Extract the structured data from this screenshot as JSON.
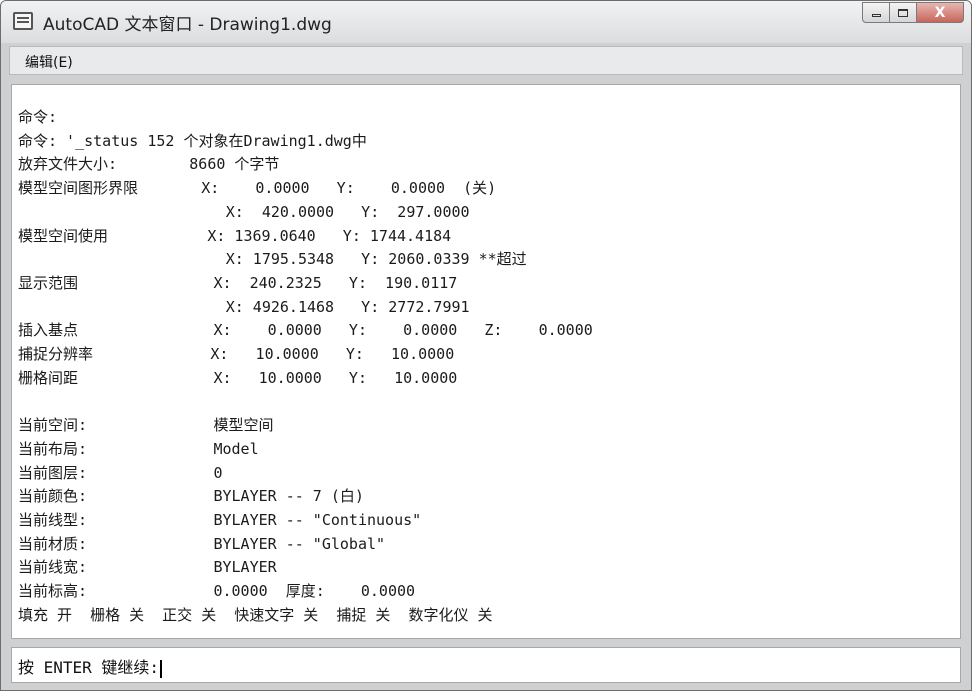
{
  "window": {
    "title": "AutoCAD 文本窗口 - Drawing1.dwg",
    "minimize_symbol": "",
    "maximize_symbol": "",
    "close_symbol": "X"
  },
  "menubar": {
    "edit_label": "编辑(E)"
  },
  "console": {
    "lines": [
      "命令:",
      "命令: '_status 152 个对象在Drawing1.dwg中",
      "放弃文件大小:        8660 个字节",
      "模型空间图形界限       X:    0.0000   Y:    0.0000  (关)",
      "                       X:  420.0000   Y:  297.0000",
      "模型空间使用           X: 1369.0640   Y: 1744.4184",
      "                       X: 1795.5348   Y: 2060.0339 **超过",
      "显示范围               X:  240.2325   Y:  190.0117",
      "                       X: 4926.1468   Y: 2772.7991",
      "插入基点               X:    0.0000   Y:    0.0000   Z:    0.0000",
      "捕捉分辨率             X:   10.0000   Y:   10.0000",
      "栅格间距               X:   10.0000   Y:   10.0000",
      "",
      "当前空间:              模型空间",
      "当前布局:              Model",
      "当前图层:              0",
      "当前颜色:              BYLAYER -- 7 (白)",
      "当前线型:              BYLAYER -- \"Continuous\"",
      "当前材质:              BYLAYER -- \"Global\"",
      "当前线宽:              BYLAYER",
      "当前标高:              0.0000  厚度:    0.0000",
      "填充 开  栅格 关  正交 关  快速文字 关  捕捉 关  数字化仪 关"
    ]
  },
  "command_input": {
    "prompt": "按 ENTER 键继续:"
  }
}
